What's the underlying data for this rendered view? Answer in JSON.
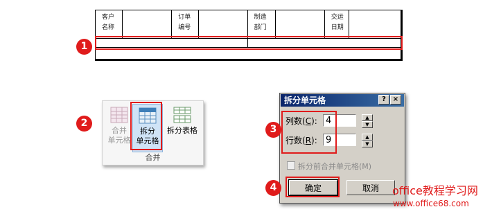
{
  "table": {
    "headers": [
      {
        "line1": "客户",
        "line2": "名称"
      },
      {
        "line1": "订单",
        "line2": "编号"
      },
      {
        "line1": "制造",
        "line2": "部门"
      },
      {
        "line1": "交运",
        "line2": "日期"
      }
    ]
  },
  "markers": [
    "1",
    "2",
    "3",
    "4"
  ],
  "ribbon": {
    "merge": {
      "line1": "合并",
      "line2": "单元格"
    },
    "split_cells": {
      "line1": "拆分",
      "line2": "单元格"
    },
    "split_table": "拆分表格",
    "group_label": "合并"
  },
  "dialog": {
    "title": "拆分单元格",
    "help_button": "?",
    "close_button": "×",
    "columns": {
      "label_prefix": "列数(",
      "access_key": "C",
      "label_suffix": "):",
      "value": "4"
    },
    "rows": {
      "label_prefix": "行数(",
      "access_key": "R",
      "label_suffix": "):",
      "value": "9"
    },
    "merge_before_split": {
      "label": "拆分前合并单元格(M)",
      "checked": false
    },
    "ok": "确定",
    "cancel": "取消"
  },
  "watermark": {
    "line1": "office教程学习网",
    "line2": "www.office68.com"
  },
  "colors": {
    "accent": "#e01b1b",
    "title_bar": "#0a246a",
    "dialog_bg": "#d4d0c8"
  }
}
